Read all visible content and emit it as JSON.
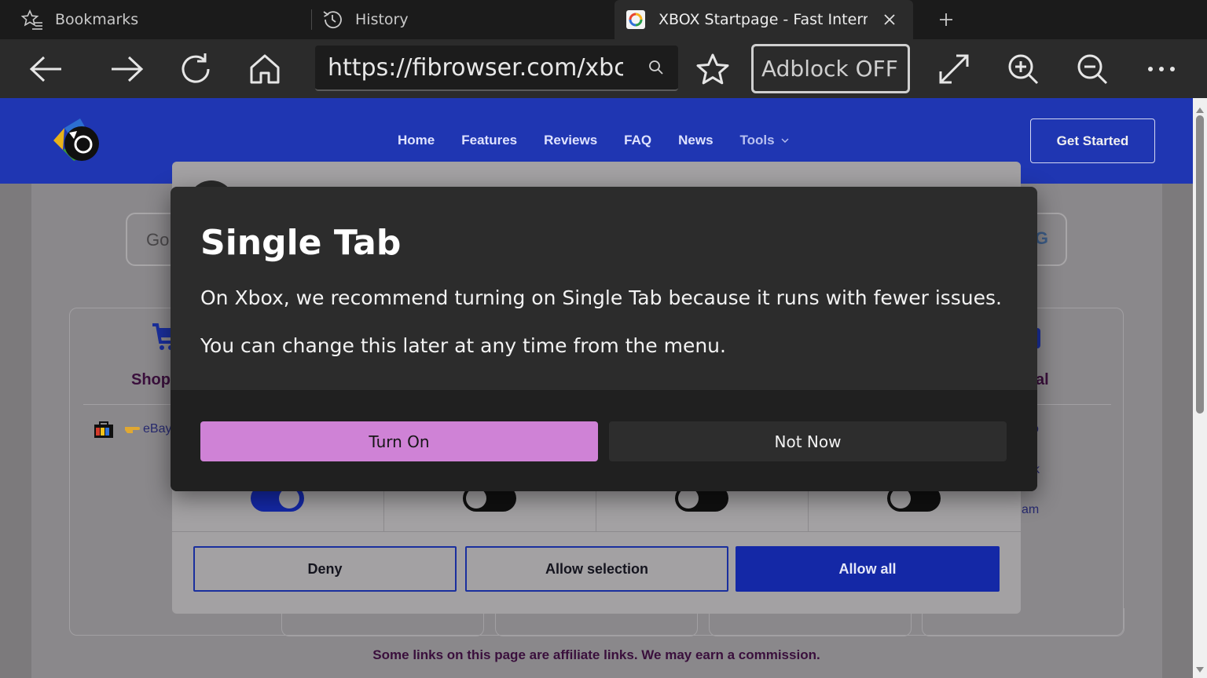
{
  "browser": {
    "tabs": [
      {
        "label": "Bookmarks",
        "icon": "star-list-icon"
      },
      {
        "label": "History",
        "icon": "history-icon"
      },
      {
        "label": "XBOX Startpage - Fast Interne",
        "icon": "site-favicon",
        "active": true
      }
    ],
    "toolbar": {
      "url": "https://fibrowser.com/xbc",
      "adblock_label": "Adblock OFF"
    }
  },
  "site": {
    "nav": [
      "Home",
      "Features",
      "Reviews",
      "FAQ",
      "News",
      "Tools"
    ],
    "cta": "Get Started",
    "search_placeholder": "Go",
    "search_g": "G",
    "shop_label": "Shop",
    "right_label": "al",
    "ebay_link": "eBay",
    "right_links": [
      "o",
      "k",
      "am"
    ],
    "affiliate_notice": "Some links on this page are affiliate links. We may earn a commission."
  },
  "consent": {
    "deny": "Deny",
    "allow_selection": "Allow selection",
    "allow_all": "Allow all",
    "toggles": [
      true,
      false,
      false,
      false
    ]
  },
  "dialog": {
    "title": "Single Tab",
    "line1": "On Xbox, we recommend turning on Single Tab because it runs with fewer issues.",
    "line2": "You can change this later at any time from the menu.",
    "primary": "Turn On",
    "secondary": "Not Now"
  },
  "colors": {
    "brand_blue": "#1f36b2",
    "dialog_primary": "#cf82d6"
  }
}
